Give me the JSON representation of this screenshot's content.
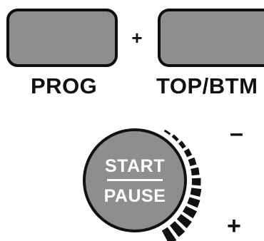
{
  "keys": {
    "prog_label": "PROG",
    "combo_symbol": "+",
    "topbtm_label": "TOP/BTM"
  },
  "start_pause": {
    "line1": "START",
    "line2": "PAUSE"
  },
  "speed_scale": {
    "minus_symbol": "–",
    "plus_symbol": "+"
  },
  "colors": {
    "button_fill": "#8e8e8e",
    "outline": "#111111",
    "text_on_button": "#ffffff"
  }
}
